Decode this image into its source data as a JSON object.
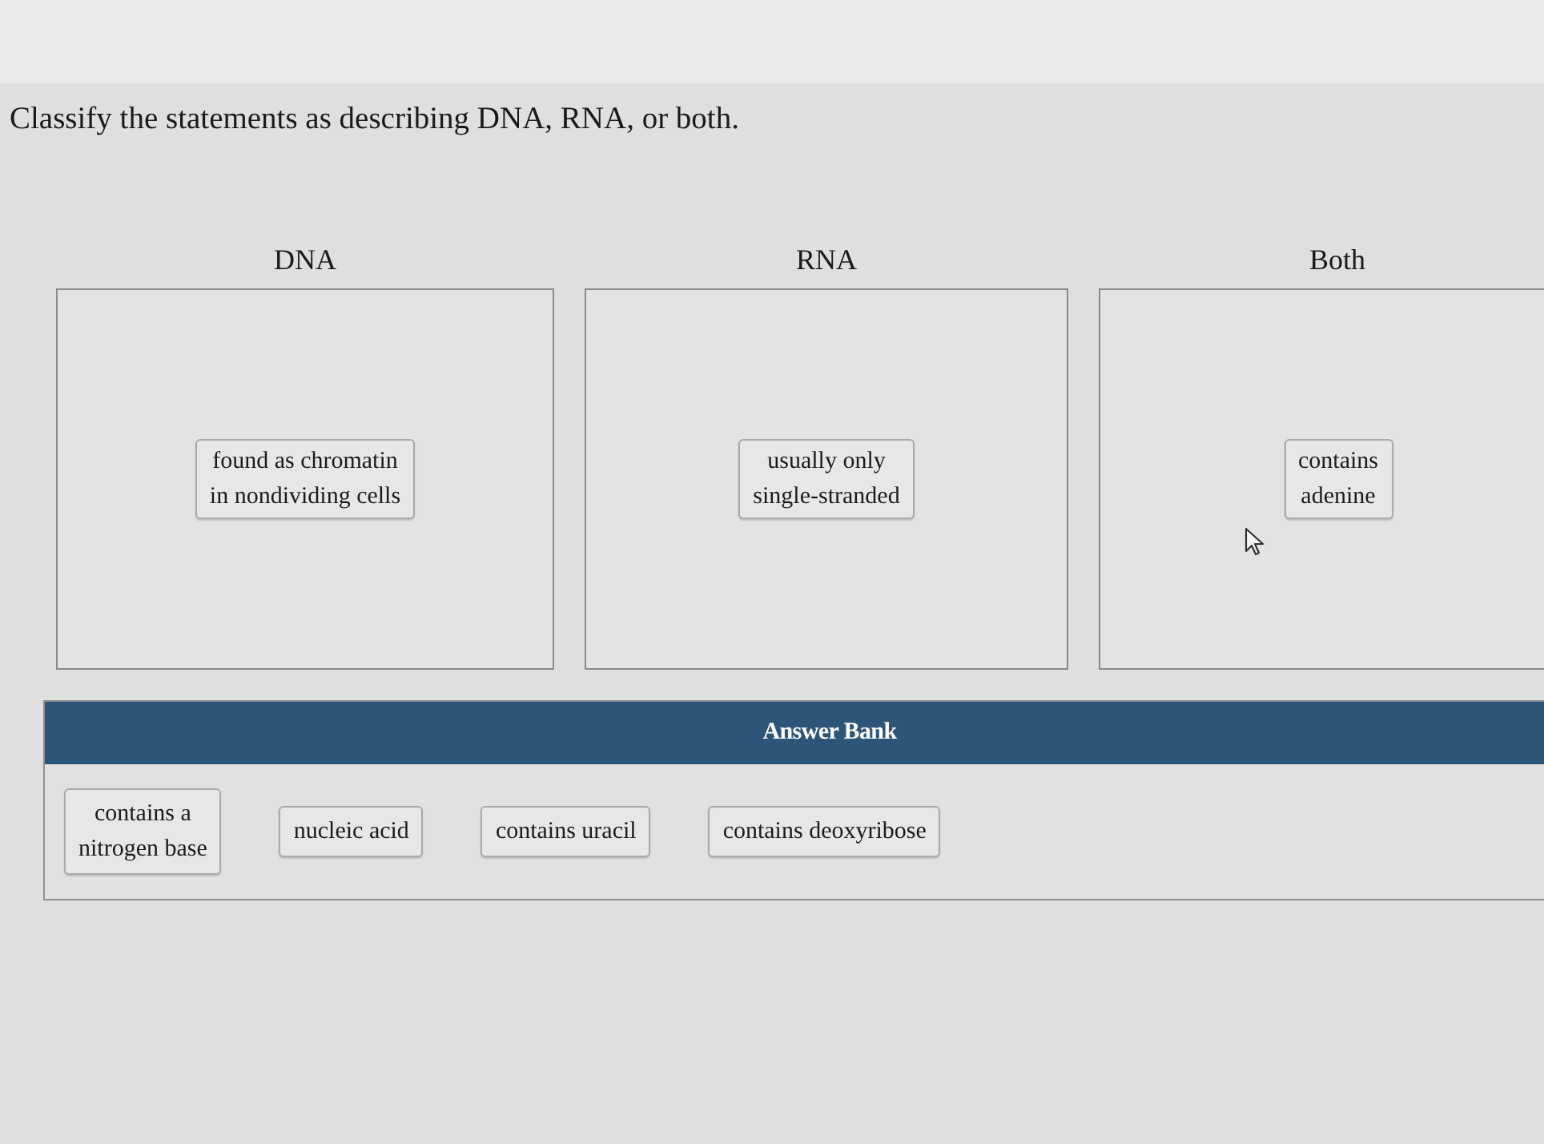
{
  "question": "Classify the statements as describing DNA, RNA, or both.",
  "bins": [
    {
      "heading": "DNA",
      "items": [
        "found as chromatin\nin nondividing cells"
      ]
    },
    {
      "heading": "RNA",
      "items": [
        "usually only\nsingle-stranded"
      ]
    },
    {
      "heading": "Both",
      "items": [
        "contains\nadenine"
      ]
    }
  ],
  "answer_bank": {
    "title": "Answer Bank",
    "items": [
      "contains a\nnitrogen base",
      "nucleic acid",
      "contains uracil",
      "contains deoxyribose"
    ]
  }
}
